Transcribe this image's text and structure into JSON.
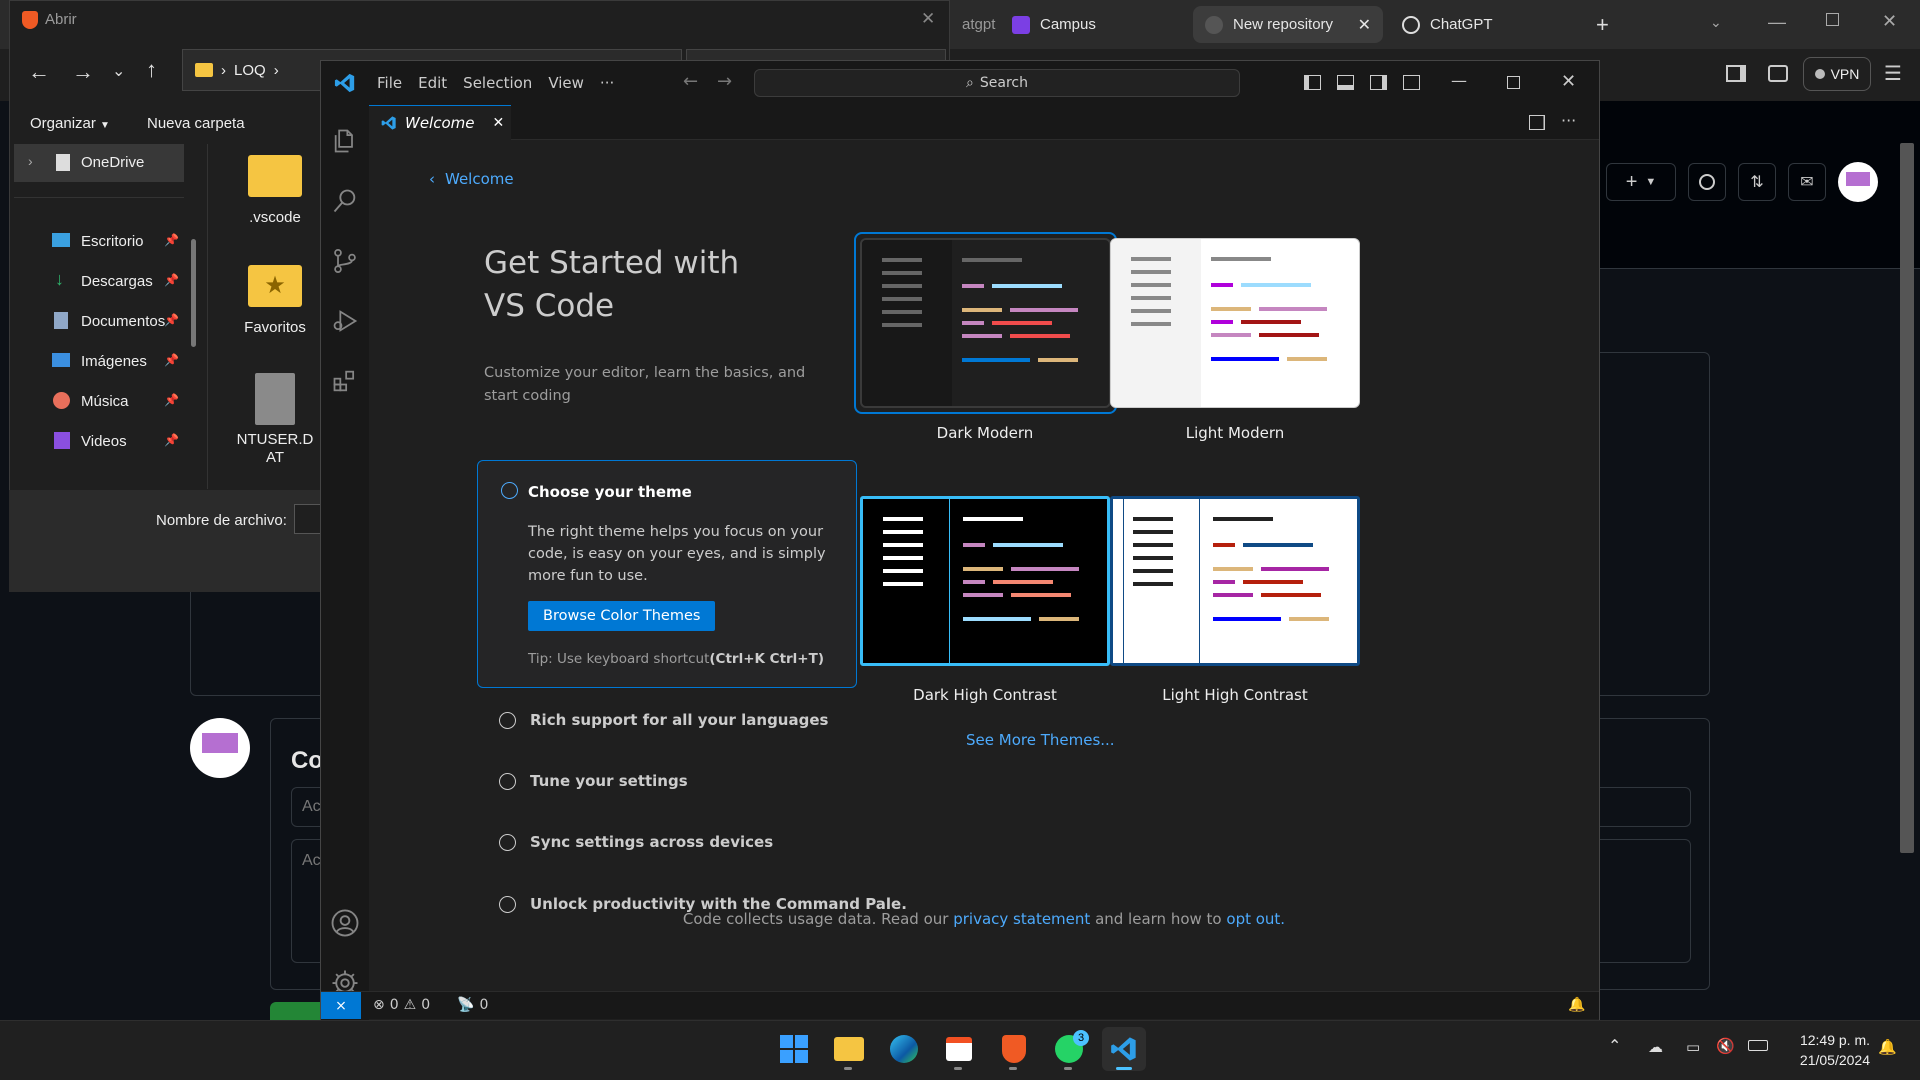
{
  "browser": {
    "tabs": [
      {
        "label": "atgpt"
      },
      {
        "label": "Campus"
      },
      {
        "label": "New repository"
      },
      {
        "label": "ChatGPT"
      }
    ],
    "vpn_label": "VPN",
    "github_fragments": [
      "Co",
      "Ac",
      "Ac"
    ]
  },
  "file_dialog": {
    "title": "Abrir",
    "path_segment": "LOQ",
    "organize_label": "Organizar",
    "new_folder_label": "Nueva carpeta",
    "nav_items": [
      {
        "label": "OneDrive"
      },
      {
        "label": "Escritorio"
      },
      {
        "label": "Descargas"
      },
      {
        "label": "Documentos"
      },
      {
        "label": "Imágenes"
      },
      {
        "label": "Música"
      },
      {
        "label": "Videos"
      }
    ],
    "files": [
      {
        "name": ".vscode"
      },
      {
        "name": "Favoritos"
      },
      {
        "name": "NTUSER.DAT"
      }
    ],
    "filename_label": "Nombre de archivo:"
  },
  "vscode": {
    "menu": [
      "File",
      "Edit",
      "Selection",
      "View",
      "···"
    ],
    "search_placeholder": "Search",
    "tab_label": "Welcome",
    "breadcrumb": "Welcome",
    "heading": "Get Started with VS Code",
    "subheading": "Customize your editor, learn the basics, and start coding",
    "steps": {
      "active": {
        "title": "Choose your theme",
        "description": "The right theme helps you focus on your code, is easy on your eyes, and is simply more fun to use.",
        "button": "Browse Color Themes",
        "tip_prefix": "Tip: Use keyboard shortcut",
        "tip_shortcut": "(Ctrl+K Ctrl+T)"
      },
      "others": [
        "Rich support for all your languages",
        "Tune your settings",
        "Sync settings across devices",
        "Unlock productivity with the Command Pale."
      ]
    },
    "themes": [
      {
        "label": "Dark Modern"
      },
      {
        "label": "Light Modern"
      },
      {
        "label": "Dark High Contrast"
      },
      {
        "label": "Light High Contrast"
      }
    ],
    "see_more": "See More Themes...",
    "footer": {
      "text1": "Code collects usage data. Read our",
      "link1": "privacy statement",
      "text2": "and learn how to",
      "link2": "opt out."
    },
    "status": {
      "errors": "0",
      "warnings": "0",
      "ports": "0"
    },
    "colors": {
      "accent": "#0078d4",
      "link": "#4daafc"
    }
  },
  "taskbar": {
    "time": "12:49 p. m.",
    "date": "21/05/2024",
    "whatsapp_badge": "3"
  }
}
